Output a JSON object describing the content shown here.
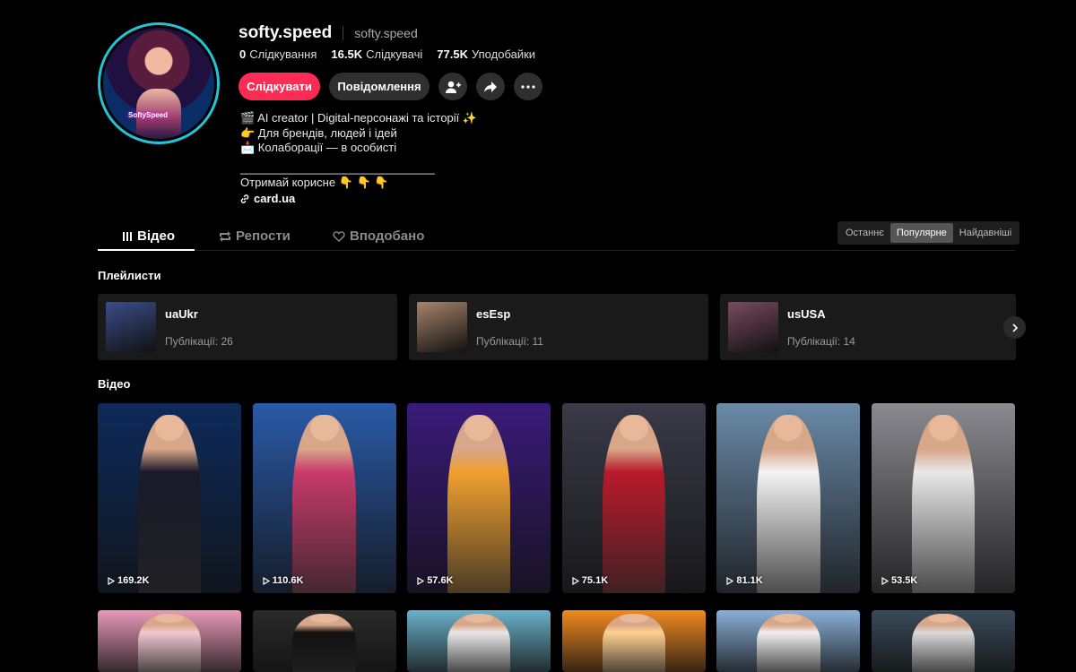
{
  "profile": {
    "username": "softy.speed",
    "nickname": "softy.speed",
    "avatar_label": "SoftySpeed",
    "stats": [
      {
        "value": "0",
        "label": "Слідкування"
      },
      {
        "value": "16.5K",
        "label": "Слідкувачі"
      },
      {
        "value": "77.5K",
        "label": "Уподобайки"
      }
    ]
  },
  "actions": {
    "follow_label": "Слідкувати",
    "message_label": "Повідомлення",
    "icons": [
      "add-friend-icon",
      "share-icon",
      "more-icon"
    ]
  },
  "bio": {
    "lines": [
      "🎬 AI creator | Digital-персонажі та історії ✨",
      "👉 Для брендів, людей і ідей",
      "📩 Колаборації — в особисті"
    ],
    "rule": "______________________________",
    "cta": "Отримай корисне 👇 👇 👇",
    "link": "card.ua"
  },
  "tabs": [
    {
      "label": "Відео",
      "icon": "grid-icon",
      "active": true
    },
    {
      "label": "Репости",
      "icon": "repost-icon",
      "active": false
    },
    {
      "label": "Вподобано",
      "icon": "liked-icon",
      "active": false
    }
  ],
  "sort": {
    "options": [
      "Останнє",
      "Популярне",
      "Найдавніші"
    ],
    "selected": "Популярне"
  },
  "playlists_title": "Плейлисти",
  "playlists": [
    {
      "name": "uaUkr",
      "count": "Публікації: 26",
      "color": "#3a4d8a"
    },
    {
      "name": "esEsp",
      "count": "Публікації: 11",
      "color": "#a8846a"
    },
    {
      "name": "usUSA",
      "count": "Публікації: 14",
      "color": "#7a4a5e"
    }
  ],
  "videos_title": "Відео",
  "videos": [
    {
      "views": "169.2K",
      "bg": "#0d2a5a",
      "accent": "#1a1a2a"
    },
    {
      "views": "110.6K",
      "bg": "#2a5aa8",
      "accent": "#c83a6a"
    },
    {
      "views": "57.6K",
      "bg": "#3a1a7a",
      "accent": "#f0a030"
    },
    {
      "views": "75.1K",
      "bg": "#3a3a48",
      "accent": "#b81a2a"
    },
    {
      "views": "81.1K",
      "bg": "#6a8aa8",
      "accent": "#f4f4f4"
    },
    {
      "views": "53.5K",
      "bg": "#8a8a90",
      "accent": "#e8e8e8"
    },
    {
      "views": "",
      "bg": "#e89ab8",
      "accent": "#f0c8d0"
    },
    {
      "views": "",
      "bg": "#2a2a2a",
      "accent": "#111111"
    },
    {
      "views": "",
      "bg": "#6ab0c8",
      "accent": "#e8e8e8"
    },
    {
      "views": "",
      "bg": "#f08a20",
      "accent": "#ffd090"
    },
    {
      "views": "",
      "bg": "#8ab0d8",
      "accent": "#f0f0f0"
    },
    {
      "views": "",
      "bg": "#3a4a5a",
      "accent": "#d8d8d8"
    }
  ]
}
